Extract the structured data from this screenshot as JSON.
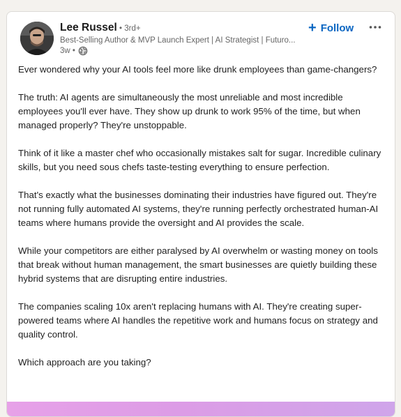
{
  "author": {
    "name": "Lee Russel",
    "degree": " • 3rd+",
    "headline": "Best-Selling Author & MVP Launch Expert | AI Strategist | Futuro...",
    "time": "3w •"
  },
  "actions": {
    "follow_label": "Follow",
    "follow_symbol": "+"
  },
  "icons": {
    "globe": "globe-icon",
    "more": "more-options-icon",
    "plus": "plus-icon"
  },
  "colors": {
    "accent": "#0a66c2",
    "media_strip": "#e0a0e8"
  },
  "post": {
    "paragraphs": [
      "Ever wondered why your AI tools feel more like drunk employees than game-changers?",
      "The truth: AI agents are simultaneously the most unreliable and most incredible employees you'll ever have. They show up drunk to work 95% of the time, but when managed properly? They're unstoppable.",
      "Think of it like a master chef who occasionally mistakes salt for sugar. Incredible culinary skills, but you need sous chefs taste-testing everything to ensure perfection.",
      "That's exactly what the businesses dominating their industries have figured out. They're not running fully automated AI systems, they're running perfectly orchestrated human-AI teams where humans provide the oversight and AI provides the scale.",
      "While your competitors are either paralysed by AI overwhelm or wasting money on tools that break without human management, the smart businesses are quietly building these hybrid systems that are disrupting entire industries.",
      "The companies scaling 10x aren't replacing humans with AI. They're creating super-powered teams where AI handles the repetitive work and humans focus on strategy and quality control.",
      "Which approach are you taking?"
    ]
  }
}
